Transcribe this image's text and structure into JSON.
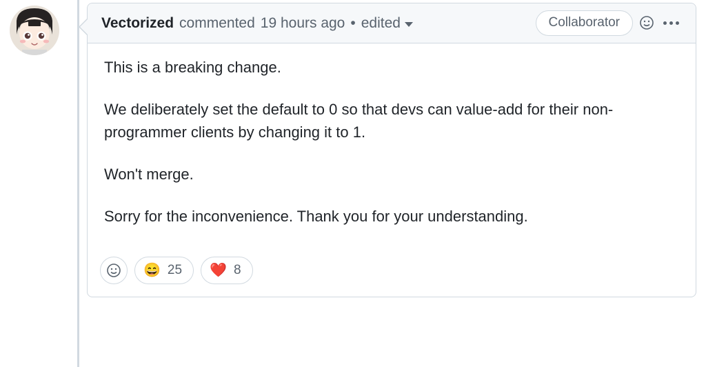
{
  "comment": {
    "author": "Vectorized",
    "action": "commented",
    "timestamp": "19 hours ago",
    "edited_label": "edited",
    "role_badge": "Collaborator",
    "body": {
      "p1": "This is a breaking change.",
      "p2": "We deliberately set the default to 0 so that devs can value-add for their non-programmer clients by changing it to 1.",
      "p3": "Won't merge.",
      "p4": "Sorry for the inconvenience. Thank you for your understanding."
    },
    "reactions": [
      {
        "emoji": "😄",
        "count": "25"
      },
      {
        "emoji": "❤️",
        "count": "8"
      }
    ]
  }
}
